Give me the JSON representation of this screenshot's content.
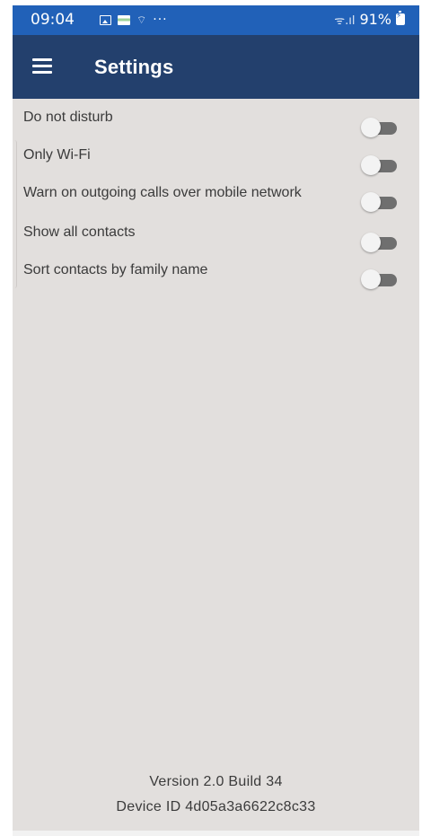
{
  "status_bar": {
    "time": "09:04",
    "icons": [
      "image-icon",
      "app-notification-icon",
      "wifi-notification-icon",
      "more-icon"
    ],
    "more": "···",
    "signal": "ᯤ.ıl",
    "battery_percent": "91%",
    "battery_level": 0.91
  },
  "app_bar": {
    "menu_icon": "hamburger-menu-icon",
    "title": "Settings",
    "background_color": "#23406d"
  },
  "settings": [
    {
      "label": "Do not disturb",
      "enabled": false
    },
    {
      "label": "Only Wi-Fi",
      "enabled": false
    },
    {
      "label": "Warn on outgoing calls over mobile network",
      "enabled": false
    },
    {
      "label": "Show all contacts",
      "enabled": false
    },
    {
      "label": "Sort contacts by family name",
      "enabled": false
    }
  ],
  "footer": {
    "version": "Version 2.0 Build 34",
    "device_id": "Device ID 4d05a3a6622c8c33"
  },
  "colors": {
    "status_bar": "#2161b8",
    "background": "#e2dfdd",
    "toggle_off_track": "#6f6f6f",
    "toggle_off_thumb": "#f3f3f3"
  }
}
